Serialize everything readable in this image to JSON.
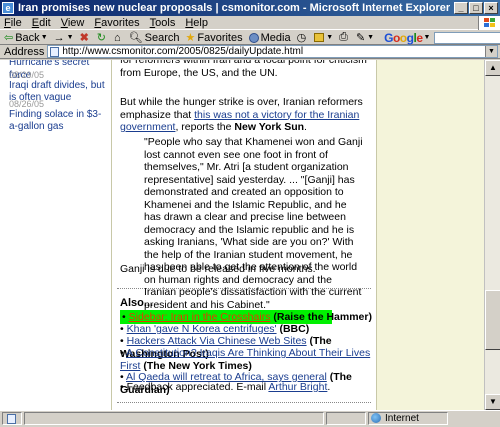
{
  "window": {
    "title": "Iran promises new nuclear proposals | csmonitor.com - Microsoft Internet Explorer",
    "app_icon": "e"
  },
  "menu": [
    "File",
    "Edit",
    "View",
    "Favorites",
    "Tools",
    "Help"
  ],
  "toolbar": {
    "back": "Back",
    "forward": "→",
    "search": "Search",
    "favorites": "Favorites",
    "media": "Media",
    "google_label": "Google"
  },
  "address": {
    "label": "Address",
    "url": "http://www.csmonitor.com/2005/0825/dailyUpdate.html"
  },
  "left_column": {
    "partial_top": "Hurricane's secret force",
    "items": [
      {
        "date": "08/29/05",
        "title": "Iraqi draft divides, but is often vague"
      },
      {
        "date": "08/26/05",
        "title": "Finding solace in $3-a-gallon gas"
      }
    ]
  },
  "article": {
    "para_top_fragment": "reformers within Iran and a focal point for criticism from Europe, the US, and the UN.",
    "para_top_partial": "for reformers within Iran and a focal point for criticism from Europe, the US, and the UN.",
    "para2_pre": "But while the hunger strike is over, Iranian reformers emphasize that ",
    "para2_link": "this was not a victory for the Iranian government",
    "para2_mid": ", reports the ",
    "para2_source": "New York Sun",
    "para2_end": ".",
    "quote": "\"People who say that Khamenei won and Ganji lost cannot even see one foot in front of themselves,\" Mr. Atri [a student organization representative] said yesterday. ... \"[Ganji] has demonstrated and created an opposition to Khamenei and the Islamic Republic, and he has drawn a clear and precise line between democracy and the Islamic republic and he is asking Iranians, 'What side are you on?' With the help of the Iranian student movement, he has been able to get the attention of the world on human rights and democracy and the Iranian people's dissatisfaction with the current president and his Cabinet.\"",
    "closing": "Ganji is due to be released in five months."
  },
  "also": {
    "heading": "Also...",
    "items": [
      {
        "bullet": "•",
        "link": "Sidebar: Iran in the Crosshairs",
        "source": "(Raise the Hammer)",
        "highlighted": true
      },
      {
        "bullet": "•",
        "link": "Khan 'gave N Korea centrifuges'",
        "source": "(BBC)"
      },
      {
        "bullet": "•",
        "link": "Hackers Attack Via Chinese Web Sites",
        "source": "(The Washington Post)"
      },
      {
        "bullet": "•",
        "link": "A Constitution? Iraqis Are Thinking About Their Lives First",
        "source": "(The New York Times)"
      },
      {
        "bullet": "•",
        "link": "Al Qaeda will retreat to Africa, says general",
        "source": "(The Guardian)"
      }
    ],
    "feedback_pre": "• Feedback appreciated. E-mail ",
    "feedback_link": "Arthur Bright",
    "feedback_end": "."
  },
  "status": {
    "zone": "Internet"
  }
}
